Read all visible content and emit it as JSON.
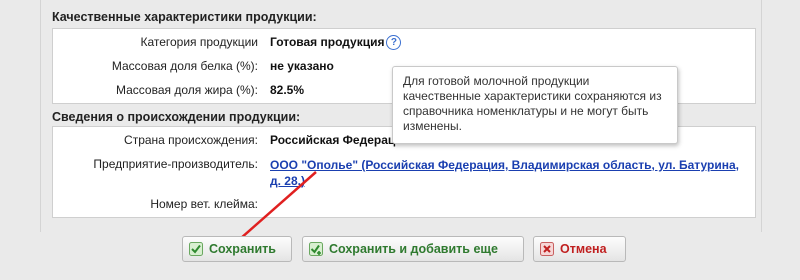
{
  "quality": {
    "title": "Качественные характеристики продукции:",
    "rows": [
      {
        "label": "Категория продукции",
        "value": "Готовая продукция"
      },
      {
        "label": "Массовая доля белка (%):",
        "value": "не указано"
      },
      {
        "label": "Массовая доля жира (%):",
        "value": "82.5%"
      }
    ]
  },
  "origin": {
    "title": "Сведения о происхождении продукции:",
    "country_label": "Страна происхождения:",
    "country_value": "Российская Федерац...",
    "producer_label": "Предприятие-производитель:",
    "producer_link": "ООО \"Ополье\" (Российская Федерация, Владимирская область, ул. Батурина, д. 28.)",
    "stamp_label": "Номер вет. клейма:",
    "stamp_value": ""
  },
  "tooltip": {
    "text": "Для готовой молочной продукции качественные характеристики сохраняются из справочника номенклатуры и не могут быть изменены."
  },
  "buttons": {
    "save": "Сохранить",
    "save_add": "Сохранить и добавить еще",
    "cancel": "Отмена"
  },
  "icons": {
    "help": "question-circle-icon",
    "save": "check-icon",
    "save_add": "check-plus-icon",
    "cancel": "x-icon"
  },
  "colors": {
    "link": "#1a3fb0",
    "save_text": "#2f7a2f",
    "cancel_text": "#c02020",
    "annotation_arrow": "#e02020"
  }
}
